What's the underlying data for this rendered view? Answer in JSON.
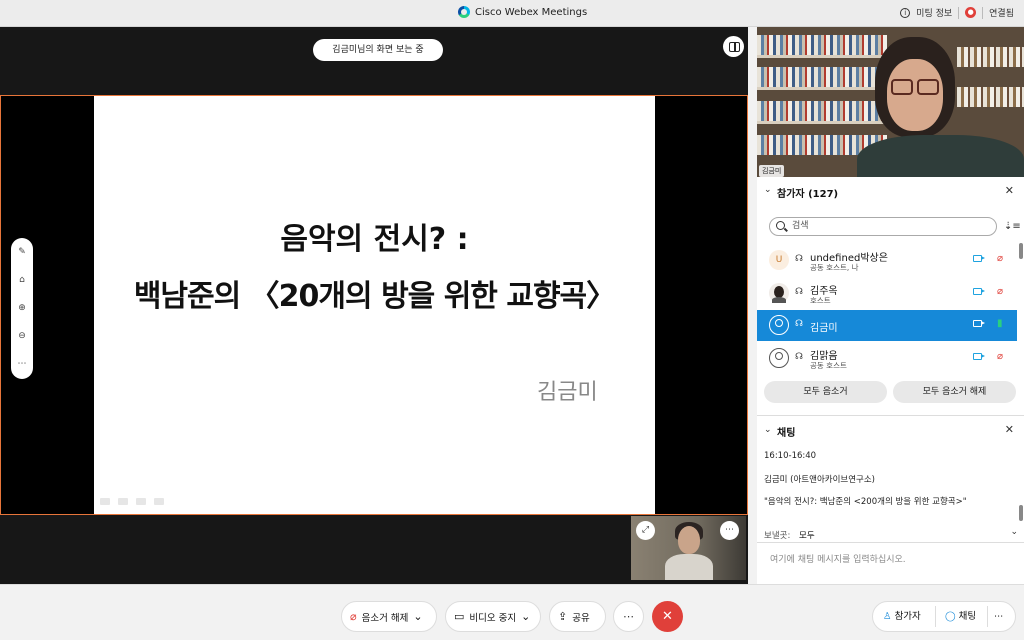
{
  "titlebar": {
    "app_title": "Cisco Webex Meetings",
    "meeting_info": "미팅 정보",
    "connection": "연결됨",
    "info_glyph": "i",
    "rec_glyph": "●"
  },
  "stage": {
    "share_label": "김금미님의 화면 보는 중",
    "slide": {
      "title_line1": "음악의 전시? :",
      "title_line2": "백남준의 〈20개의 방을 위한 교향곡〉",
      "author": "김금미"
    },
    "annotation_tools": [
      "✎",
      "⌂",
      "⊕",
      "⊖",
      "⋯"
    ],
    "selfview_buttons": [
      "⤢",
      "⋯"
    ]
  },
  "speaker": {
    "name": "김금미"
  },
  "participants": {
    "title": "참가자 (127)",
    "search_placeholder": "검색",
    "items": [
      {
        "avatar": "U",
        "name": "undefined박상은",
        "role": "공동 호스트, 나",
        "mic": "off"
      },
      {
        "avatar": "",
        "name": "김주옥",
        "role": "호스트",
        "mic": "off"
      },
      {
        "avatar": "",
        "name": "김금미",
        "role": "",
        "mic": "on"
      },
      {
        "avatar": "",
        "name": "김맑음",
        "role": "공동 호스트",
        "mic": "off"
      }
    ],
    "mute_all": "모두 음소거",
    "unmute_all": "모두 음소거 해제"
  },
  "chat": {
    "title": "채팅",
    "messages": [
      "16:10-16:40",
      "김금미 (아트앤아카이브연구소)",
      "\"음악의 전시?: 백남준의 <200개의 방을 위한 교향곡>\""
    ],
    "send_to_label": "보낼곳:",
    "send_to_value": "모두",
    "input_placeholder": "여기에 채팅 메시지를 입력하십시오."
  },
  "toolbar": {
    "unmute": "음소거 해제",
    "stop_video": "비디오 중지",
    "share": "공유",
    "participants": "참가자",
    "chat": "채팅"
  },
  "colors": {
    "accent": "#1689d8",
    "leave": "#e0403a",
    "share_border": "#e7753a"
  }
}
